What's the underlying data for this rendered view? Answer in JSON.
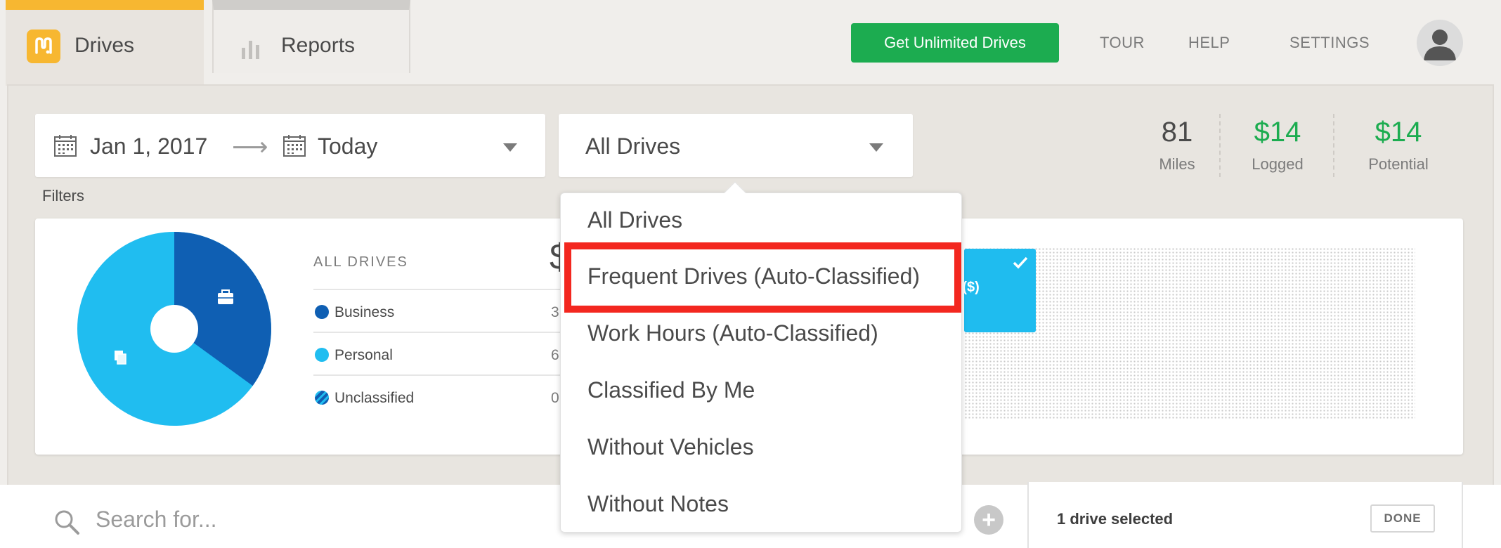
{
  "tabs": {
    "drives": "Drives",
    "reports": "Reports"
  },
  "header": {
    "cta": "Get Unlimited Drives",
    "nav": [
      "TOUR",
      "HELP",
      "SETTINGS"
    ]
  },
  "date_range": {
    "start": "Jan 1, 2017",
    "end": "Today"
  },
  "filter": {
    "selected": "All Drives",
    "label": "Filters",
    "options": [
      "All Drives",
      "Frequent Drives (Auto-Classified)",
      "Work Hours (Auto-Classified)",
      "Classified By Me",
      "Without Vehicles",
      "Without Notes"
    ],
    "highlighted_option": "Frequent Drives (Auto-Classified)"
  },
  "stats": [
    {
      "value": "81",
      "label": "Miles",
      "color": "#4a4a4a"
    },
    {
      "value": "$14",
      "label": "Logged",
      "color": "#1cac50"
    },
    {
      "value": "$14",
      "label": "Potential",
      "color": "#1cac50"
    }
  ],
  "summary": {
    "title": "ALL DRIVES",
    "big_value_partial": "$",
    "rows": [
      {
        "label": "Business",
        "value_partial": "3",
        "color": "#0f5fb3"
      },
      {
        "label": "Personal",
        "value_partial": "6",
        "color": "#20bdf0"
      },
      {
        "label": "Unclassified",
        "value_partial": "0",
        "color": "#0f5fb3"
      }
    ],
    "pie": {
      "business_fraction": 0.35,
      "personal_fraction": 0.65
    },
    "bar_partial_label": "ty ($)"
  },
  "search": {
    "placeholder": "Search for..."
  },
  "selection": {
    "text": "1 drive selected",
    "done": "DONE"
  },
  "colors": {
    "brand_yellow": "#f7b731",
    "cta_green": "#1cac50",
    "business_blue": "#0f5fb3",
    "personal_blue": "#20bdf0",
    "highlight_red": "#f3271f"
  }
}
